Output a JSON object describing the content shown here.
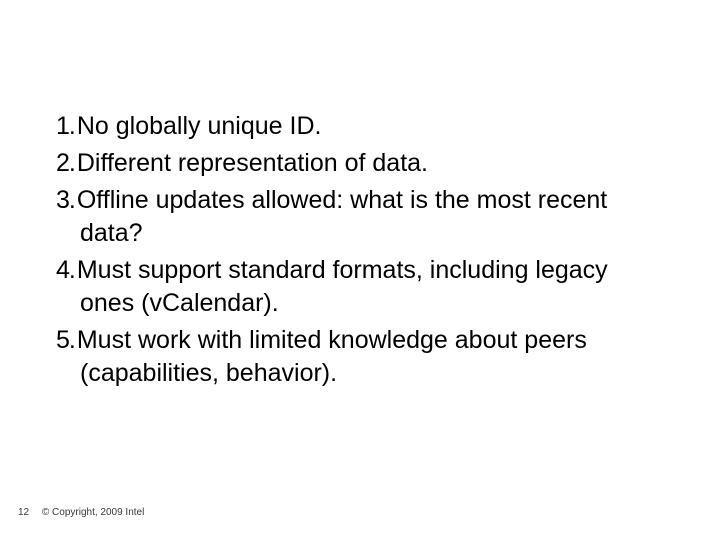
{
  "list": {
    "items": [
      "No globally unique ID.",
      "Different representation of data.",
      "Offline updates allowed: what is the most recent data?",
      "Must support standard formats, including legacy ones  (vCalendar).",
      "Must work with limited knowledge about peers (capabilities, behavior)."
    ]
  },
  "footer": {
    "page": "12",
    "copyright": "© Copyright, 2009 Intel"
  }
}
